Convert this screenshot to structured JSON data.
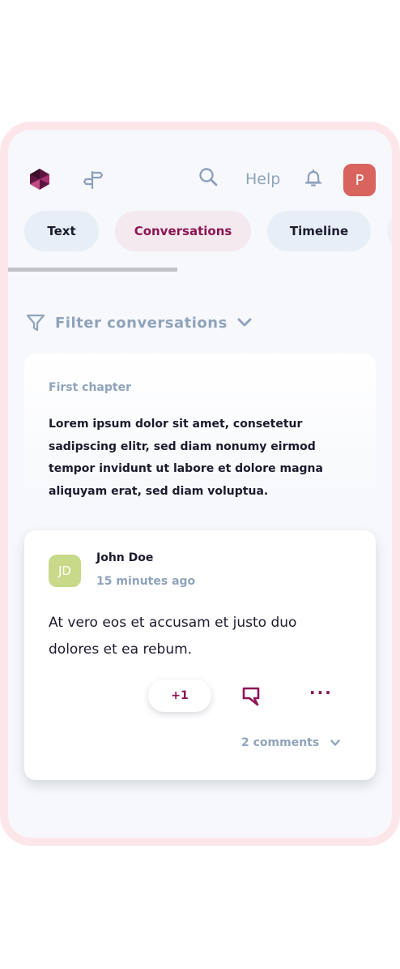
{
  "header": {
    "help_label": "Help",
    "user_initial": "P",
    "colors": {
      "brand": "#7a1b4f",
      "accent": "#8c1554",
      "muted": "#8fa3bb",
      "user_avatar": "#d9645e"
    },
    "icons": [
      "logo-icon",
      "signpost-icon",
      "search-icon",
      "bell-icon"
    ]
  },
  "tabs": [
    {
      "label": "Text",
      "selected": false
    },
    {
      "label": "Conversations",
      "selected": true
    },
    {
      "label": "Timeline",
      "selected": false
    },
    {
      "label": "",
      "selected": false
    }
  ],
  "scroll_progress": 0.44,
  "filter": {
    "label": "Filter conversations"
  },
  "chapter": {
    "title": "First chapter",
    "text": "Lorem ipsum dolor sit amet, consetetur sadipscing elitr, sed diam nonumy eirmod tempor invidunt ut labore et dolore magna aliquyam erat, sed diam voluptua."
  },
  "comment": {
    "initials": "JD",
    "author": "John Doe",
    "time": "15 minutes ago",
    "text": "At vero eos et accusam et justo duo dolores et ea rebum.",
    "plus_label": "+1",
    "more_label": "···",
    "comments_label": "2 comments",
    "avatar_color": "#c9d98a"
  }
}
